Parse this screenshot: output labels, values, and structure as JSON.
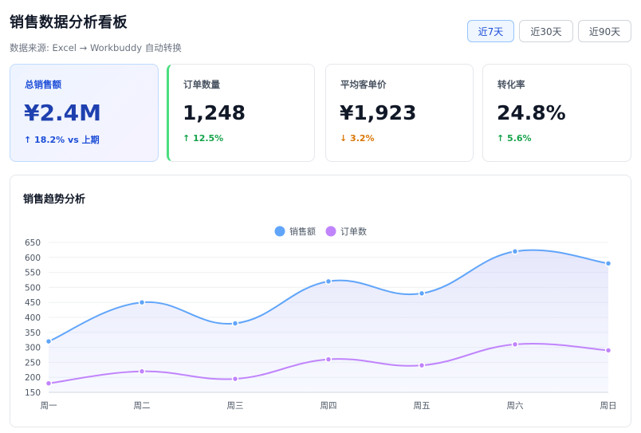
{
  "header": {
    "title": "销售数据分析看板",
    "subtitle": "数据来源: Excel → Workbuddy 自动转换"
  },
  "range_buttons": [
    {
      "label": "近7天",
      "active": true
    },
    {
      "label": "近30天",
      "active": false
    },
    {
      "label": "近90天",
      "active": false
    }
  ],
  "kpis": [
    {
      "label": "总销售额",
      "value": "¥2.4M",
      "change": "↑ 18.2% vs 上期"
    },
    {
      "label": "订单数量",
      "value": "1,248",
      "change": "↑ 12.5%"
    },
    {
      "label": "平均客单价",
      "value": "¥1,923",
      "change": "↓ 3.2%"
    },
    {
      "label": "转化率",
      "value": "24.8%",
      "change": "↑ 5.6%"
    }
  ],
  "chart_panel": {
    "title": "销售趋势分析"
  },
  "colors": {
    "sales": "#60a5fa",
    "orders": "#c084fc",
    "accent": "#1d4ed8",
    "up": "#16a34a",
    "down": "#d97706"
  },
  "chart_data": {
    "type": "line",
    "title": "销售趋势分析",
    "categories": [
      "周一",
      "周二",
      "周三",
      "周四",
      "周五",
      "周六",
      "周日"
    ],
    "series": [
      {
        "name": "销售额",
        "values": [
          320,
          450,
          380,
          520,
          480,
          620,
          580
        ]
      },
      {
        "name": "订单数",
        "values": [
          180,
          220,
          195,
          260,
          240,
          310,
          290
        ]
      }
    ],
    "ylim": [
      150,
      650
    ],
    "yticks": [
      150,
      200,
      250,
      300,
      350,
      400,
      450,
      500,
      550,
      600,
      650
    ],
    "grid": true,
    "legend": "top-center",
    "smooth": true,
    "area_fill_first_series": true
  }
}
